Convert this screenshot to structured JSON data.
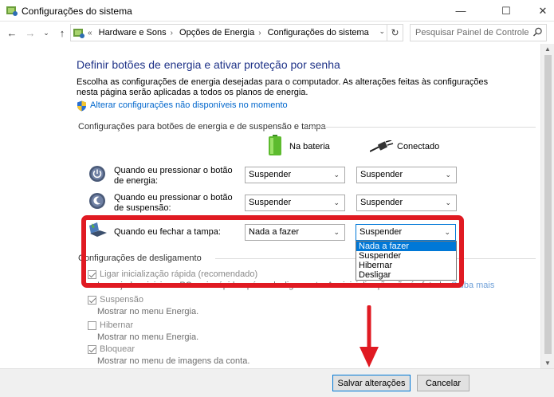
{
  "window": {
    "title": "Configurações do sistema",
    "minimize": "—",
    "maximize": "☐",
    "close": "✕"
  },
  "address": {
    "breadcrumbs": [
      "«",
      "Hardware e Sons",
      "Opções de Energia",
      "Configurações do sistema"
    ],
    "search_placeholder": "Pesquisar Painel de Controle"
  },
  "page": {
    "heading": "Definir botões de energia e ativar proteção por senha",
    "intro": "Escolha as configurações de energia desejadas para o computador. As alterações feitas às configurações nesta página serão aplicadas a todos os planos de energia.",
    "admin_link": "Alterar configurações não disponíveis no momento",
    "section_buttons": "Configurações para botões de energia e de suspensão e tampa",
    "col_battery": "Na bateria",
    "col_plugged": "Conectado",
    "rows": [
      {
        "label": "Quando eu pressionar o botão de energia:",
        "battery": "Suspender",
        "plugged": "Suspender"
      },
      {
        "label": "Quando eu pressionar o botão de suspensão:",
        "battery": "Suspender",
        "plugged": "Suspender"
      },
      {
        "label": "Quando eu fechar a tampa:",
        "battery": "Nada a fazer",
        "plugged": "Suspender"
      }
    ],
    "dropdown_options": [
      "Nada a fazer",
      "Suspender",
      "Hibernar",
      "Desligar"
    ],
    "dropdown_highlighted": "Nada a fazer",
    "section_shutdown": "Configurações de desligamento",
    "shutdown": [
      {
        "label": "Ligar inicialização rápida (recomendado)",
        "checked": true,
        "desc": "Isso ajuda a iniciar o PC mais rápido após o desligamento. A reinicialização não é afetada.",
        "more": "Saiba mais"
      },
      {
        "label": "Suspensão",
        "checked": true,
        "desc": "Mostrar no menu Energia."
      },
      {
        "label": "Hibernar",
        "checked": false,
        "desc": "Mostrar no menu Energia."
      },
      {
        "label": "Bloquear",
        "checked": true,
        "desc": "Mostrar no menu de imagens da conta."
      }
    ]
  },
  "footer": {
    "save": "Salvar alterações",
    "cancel": "Cancelar"
  },
  "colors": {
    "heading": "#1e3287",
    "link": "#0066cc",
    "highlight_box": "#e01a22",
    "selection": "#0078d7"
  }
}
